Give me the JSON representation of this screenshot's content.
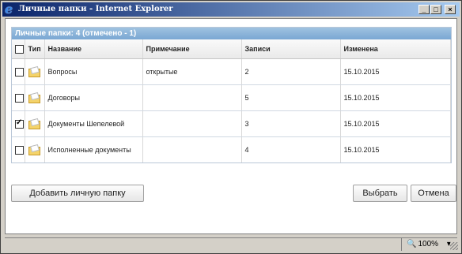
{
  "window": {
    "title": "Личные папки - Internet Explorer",
    "minimize": "_",
    "maximize": "□",
    "close": "×"
  },
  "grid": {
    "caption": "Личные папки: 4 (отмечено - 1)",
    "columns": [
      "",
      "Тип",
      "Название",
      "Примечание",
      "Записи",
      "Изменена"
    ],
    "rows": [
      {
        "checked": false,
        "name": "Вопросы",
        "note": "открытые",
        "records": "2",
        "modified": "15.10.2015"
      },
      {
        "checked": false,
        "name": "Договоры",
        "note": "",
        "records": "5",
        "modified": "15.10.2015"
      },
      {
        "checked": true,
        "name": "Документы Шепелевой",
        "note": "",
        "records": "3",
        "modified": "15.10.2015"
      },
      {
        "checked": false,
        "name": "Исполненные документы",
        "note": "",
        "records": "4",
        "modified": "15.10.2015"
      }
    ]
  },
  "buttons": {
    "add": "Добавить личную папку",
    "select": "Выбрать",
    "cancel": "Отмена"
  },
  "statusbar": {
    "zoom": "100%",
    "zoom_arrow": "▾"
  },
  "icons": {
    "app": "internet-explorer-icon",
    "row_type": "folder-icon",
    "zoom": "zoom-icon"
  }
}
